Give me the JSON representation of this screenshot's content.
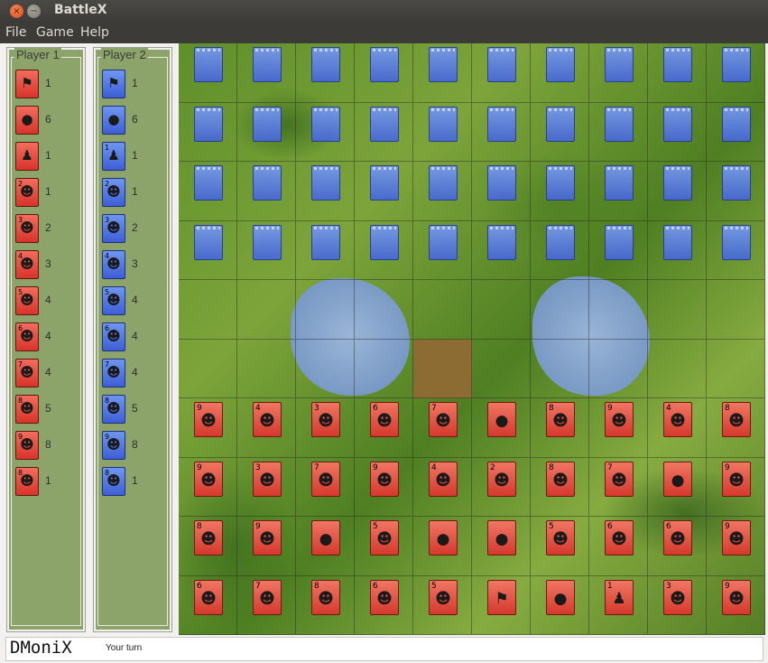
{
  "window": {
    "title": "BattleX",
    "close_glyph": "×",
    "min_glyph": "−"
  },
  "menu": [
    "File",
    "Game",
    "Help"
  ],
  "players": [
    {
      "name": "Player 1",
      "color": "#d8342a",
      "pieces": [
        {
          "rank": "",
          "icon": "flag-icon",
          "glyph": "⚑",
          "count": "1"
        },
        {
          "rank": "",
          "icon": "bomb-icon",
          "glyph": "●",
          "count": "6"
        },
        {
          "rank": "",
          "icon": "spy-icon",
          "glyph": "♟",
          "count": "1"
        },
        {
          "rank": "2",
          "icon": "soldier-icon",
          "glyph": "☻",
          "count": "1"
        },
        {
          "rank": "3",
          "icon": "soldier-icon",
          "glyph": "☻",
          "count": "2"
        },
        {
          "rank": "4",
          "icon": "soldier-icon",
          "glyph": "☻",
          "count": "3"
        },
        {
          "rank": "5",
          "icon": "soldier-icon",
          "glyph": "☻",
          "count": "4"
        },
        {
          "rank": "6",
          "icon": "soldier-icon",
          "glyph": "☻",
          "count": "4"
        },
        {
          "rank": "7",
          "icon": "soldier-icon",
          "glyph": "☻",
          "count": "4"
        },
        {
          "rank": "8",
          "icon": "soldier-icon",
          "glyph": "☻",
          "count": "5"
        },
        {
          "rank": "9",
          "icon": "soldier-icon",
          "glyph": "☻",
          "count": "8"
        },
        {
          "rank": "8",
          "icon": "soldier-icon",
          "glyph": "☻",
          "count": "1"
        }
      ]
    },
    {
      "name": "Player 2",
      "color": "#3c5fd6",
      "pieces": [
        {
          "rank": "",
          "icon": "flag-icon",
          "glyph": "⚑",
          "count": "1"
        },
        {
          "rank": "",
          "icon": "bomb-icon",
          "glyph": "●",
          "count": "6"
        },
        {
          "rank": "1",
          "icon": "spy-icon",
          "glyph": "♟",
          "count": "1"
        },
        {
          "rank": "2",
          "icon": "soldier-icon",
          "glyph": "☻",
          "count": "1"
        },
        {
          "rank": "3",
          "icon": "soldier-icon",
          "glyph": "☻",
          "count": "2"
        },
        {
          "rank": "4",
          "icon": "soldier-icon",
          "glyph": "☻",
          "count": "3"
        },
        {
          "rank": "5",
          "icon": "soldier-icon",
          "glyph": "☻",
          "count": "4"
        },
        {
          "rank": "6",
          "icon": "soldier-icon",
          "glyph": "☻",
          "count": "4"
        },
        {
          "rank": "7",
          "icon": "soldier-icon",
          "glyph": "☻",
          "count": "4"
        },
        {
          "rank": "8",
          "icon": "soldier-icon",
          "glyph": "☻",
          "count": "5"
        },
        {
          "rank": "9",
          "icon": "soldier-icon",
          "glyph": "☻",
          "count": "8"
        },
        {
          "rank": "8",
          "icon": "soldier-icon",
          "glyph": "☻",
          "count": "1"
        }
      ]
    }
  ],
  "board": {
    "rows": 10,
    "cols": 10,
    "blue_rows": [
      0,
      1,
      2,
      3
    ],
    "red_rows": [
      [
        {
          "rank": "9",
          "icon": "soldier-icon"
        },
        {
          "rank": "4",
          "icon": "soldier-icon"
        },
        {
          "rank": "3",
          "icon": "soldier-icon"
        },
        {
          "rank": "6",
          "icon": "soldier-icon"
        },
        {
          "rank": "7",
          "icon": "soldier-icon"
        },
        {
          "rank": "",
          "icon": "bomb-icon"
        },
        {
          "rank": "8",
          "icon": "soldier-icon"
        },
        {
          "rank": "9",
          "icon": "soldier-icon"
        },
        {
          "rank": "4",
          "icon": "soldier-icon"
        },
        {
          "rank": "8",
          "icon": "soldier-icon"
        }
      ],
      [
        {
          "rank": "9",
          "icon": "soldier-icon"
        },
        {
          "rank": "3",
          "icon": "soldier-icon"
        },
        {
          "rank": "7",
          "icon": "soldier-icon"
        },
        {
          "rank": "9",
          "icon": "soldier-icon"
        },
        {
          "rank": "4",
          "icon": "soldier-icon"
        },
        {
          "rank": "2",
          "icon": "soldier-icon"
        },
        {
          "rank": "8",
          "icon": "soldier-icon"
        },
        {
          "rank": "7",
          "icon": "soldier-icon"
        },
        {
          "rank": "",
          "icon": "bomb-icon"
        },
        {
          "rank": "9",
          "icon": "soldier-icon"
        }
      ],
      [
        {
          "rank": "8",
          "icon": "soldier-icon"
        },
        {
          "rank": "9",
          "icon": "soldier-icon"
        },
        {
          "rank": "",
          "icon": "bomb-icon"
        },
        {
          "rank": "5",
          "icon": "soldier-icon"
        },
        {
          "rank": "",
          "icon": "bomb-icon"
        },
        {
          "rank": "",
          "icon": "bomb-icon"
        },
        {
          "rank": "5",
          "icon": "soldier-icon"
        },
        {
          "rank": "6",
          "icon": "soldier-icon"
        },
        {
          "rank": "6",
          "icon": "soldier-icon"
        },
        {
          "rank": "9",
          "icon": "soldier-icon"
        }
      ],
      [
        {
          "rank": "6",
          "icon": "soldier-icon"
        },
        {
          "rank": "7",
          "icon": "soldier-icon"
        },
        {
          "rank": "8",
          "icon": "soldier-icon"
        },
        {
          "rank": "6",
          "icon": "soldier-icon"
        },
        {
          "rank": "5",
          "icon": "soldier-icon"
        },
        {
          "rank": "",
          "icon": "flag-icon"
        },
        {
          "rank": "",
          "icon": "bomb-icon"
        },
        {
          "rank": "1",
          "icon": "spy-icon"
        },
        {
          "rank": "3",
          "icon": "soldier-icon"
        },
        {
          "rank": "9",
          "icon": "soldier-icon"
        }
      ]
    ],
    "selected_cell": {
      "row": 5,
      "col": 4
    }
  },
  "status": {
    "logo": "DMoniX",
    "message": "Your turn"
  },
  "colors": {
    "panel_green": "#8ca46a",
    "red_piece": "#d8342a",
    "blue_piece": "#4667d9",
    "selected_cell": "#8c6c32"
  }
}
